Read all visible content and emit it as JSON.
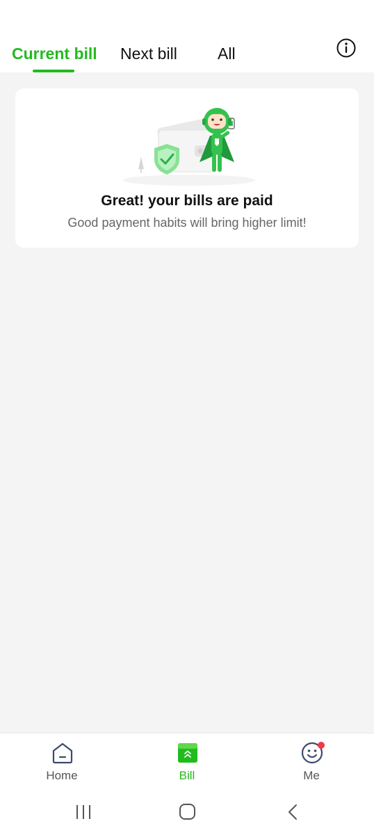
{
  "tabs": [
    {
      "label": "Current bill",
      "active": true
    },
    {
      "label": "Next bill",
      "active": false
    },
    {
      "label": "All",
      "active": false
    }
  ],
  "header": {
    "info_icon": "info-icon"
  },
  "status_card": {
    "title": "Great! your bills are paid",
    "subtitle": "Good payment habits will bring higher limit!",
    "illustration": "wallet-shield-mascot-illustration"
  },
  "bottom_nav": [
    {
      "label": "Home",
      "icon": "home-icon",
      "active": false
    },
    {
      "label": "Bill",
      "icon": "bill-icon",
      "active": true
    },
    {
      "label": "Me",
      "icon": "smiley-face-icon",
      "active": false,
      "has_badge": true
    }
  ],
  "system_nav": [
    "recent-apps-icon",
    "home-circle-icon",
    "back-chevron-icon"
  ],
  "colors": {
    "accent": "#22bb1e",
    "badge": "#f0384a",
    "background": "#f4f4f4",
    "card": "#ffffff"
  }
}
